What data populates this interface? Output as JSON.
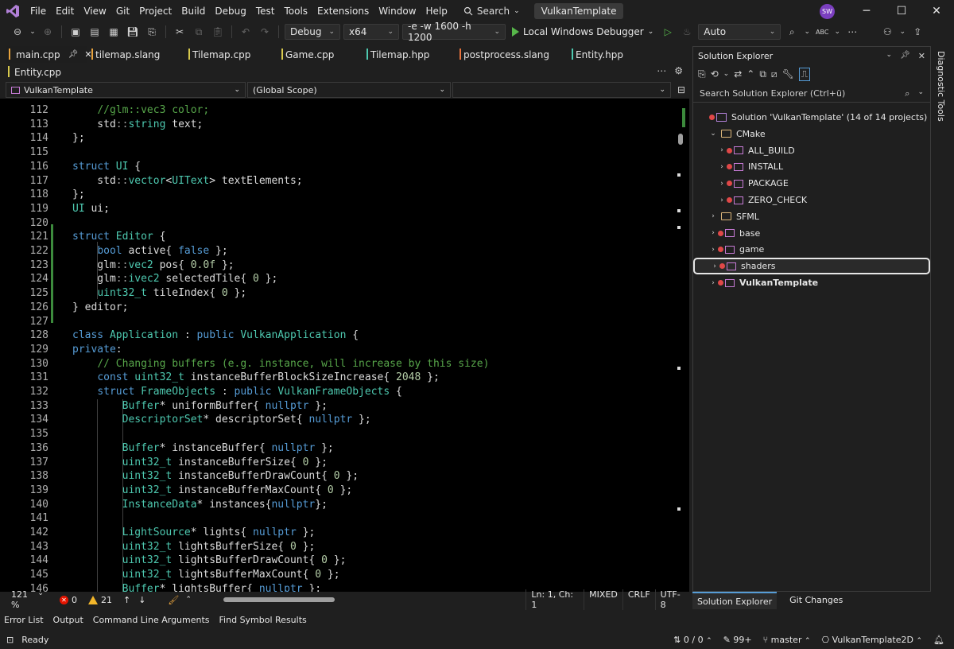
{
  "menu": {
    "items": [
      "File",
      "Edit",
      "View",
      "Git",
      "Project",
      "Build",
      "Debug",
      "Test",
      "Tools",
      "Extensions",
      "Window",
      "Help"
    ],
    "search_label": "Search",
    "solution_name": "VulkanTemplate",
    "user_initials": "SW"
  },
  "toolbar": {
    "config": "Debug",
    "platform": "x64",
    "args": "-e -w 1600 -h 1200",
    "run_label": "Local Windows Debugger",
    "auto": "Auto"
  },
  "doc_tabs": [
    {
      "label": "main.cpp",
      "color": "#e8a33d",
      "active": true
    },
    {
      "label": "tilemap.slang",
      "color": "#e8a33d"
    },
    {
      "label": "Tilemap.cpp",
      "color": "#d7c94d"
    },
    {
      "label": "Game.cpp",
      "color": "#d7c94d"
    },
    {
      "label": "Tilemap.hpp",
      "color": "#4ec9b0"
    },
    {
      "label": "postprocess.slang",
      "color": "#e8733d"
    },
    {
      "label": "Entity.hpp",
      "color": "#4ec9b0"
    },
    {
      "label": "Entity.cpp",
      "color": "#d7c94d"
    }
  ],
  "navbar": {
    "project": "VulkanTemplate",
    "scope": "(Global Scope)",
    "member": ""
  },
  "code_lines": [
    {
      "n": 112,
      "html": "    <span class=\"cm\">//glm::vec3 color;</span>"
    },
    {
      "n": 113,
      "html": "    std<span class=\"ns\">::</span><span class=\"ty\">string</span> text;"
    },
    {
      "n": 114,
      "html": "};"
    },
    {
      "n": 115,
      "html": ""
    },
    {
      "n": 116,
      "html": "<span class=\"kw\">struct</span> <span class=\"ty\">UI</span> {"
    },
    {
      "n": 117,
      "html": "    std<span class=\"ns\">::</span><span class=\"ty\">vector</span>&lt;<span class=\"ty\">UIText</span>&gt; textElements;"
    },
    {
      "n": 118,
      "html": "};"
    },
    {
      "n": 119,
      "html": "<span class=\"ty\">UI</span> ui;"
    },
    {
      "n": 120,
      "html": ""
    },
    {
      "n": 121,
      "html": "<span class=\"kw\">struct</span> <span class=\"ty\">Editor</span> {"
    },
    {
      "n": 122,
      "html": "    <span class=\"kw\">bool</span> active{ <span class=\"kw\">false</span> };"
    },
    {
      "n": 123,
      "html": "    glm<span class=\"ns\">::</span><span class=\"ty\">vec2</span> pos{ <span class=\"nu\">0.0f</span> };"
    },
    {
      "n": 124,
      "html": "    glm<span class=\"ns\">::</span><span class=\"ty\">ivec2</span> selectedTile{ <span class=\"nu\">0</span> };"
    },
    {
      "n": 125,
      "html": "    <span class=\"ty\">uint32_t</span> tileIndex{ <span class=\"nu\">0</span> };"
    },
    {
      "n": 126,
      "html": "} editor;"
    },
    {
      "n": 127,
      "html": ""
    },
    {
      "n": 128,
      "html": "<span class=\"kw\">class</span> <span class=\"ty\">Application</span> : <span class=\"kw\">public</span> <span class=\"ty\">VulkanApplication</span> {"
    },
    {
      "n": 129,
      "html": "<span class=\"kw\">private</span>:"
    },
    {
      "n": 130,
      "html": "    <span class=\"cm\">// Changing buffers (e.g. instance, will increase by this size)</span>"
    },
    {
      "n": 131,
      "html": "    <span class=\"kw\">const</span> <span class=\"ty\">uint32_t</span> instanceBufferBlockSizeIncrease{ <span class=\"nu\">2048</span> };"
    },
    {
      "n": 132,
      "html": "    <span class=\"kw\">struct</span> <span class=\"ty\">FrameObjects</span> : <span class=\"kw\">public</span> <span class=\"ty\">VulkanFrameObjects</span> {"
    },
    {
      "n": 133,
      "html": "        <span class=\"ty\">Buffer</span>* uniformBuffer{ <span class=\"kw\">nullptr</span> };"
    },
    {
      "n": 134,
      "html": "        <span class=\"ty\">DescriptorSet</span>* descriptorSet{ <span class=\"kw\">nullptr</span> };"
    },
    {
      "n": 135,
      "html": ""
    },
    {
      "n": 136,
      "html": "        <span class=\"ty\">Buffer</span>* instanceBuffer{ <span class=\"kw\">nullptr</span> };"
    },
    {
      "n": 137,
      "html": "        <span class=\"ty\">uint32_t</span> instanceBufferSize{ <span class=\"nu\">0</span> };"
    },
    {
      "n": 138,
      "html": "        <span class=\"ty\">uint32_t</span> instanceBufferDrawCount{ <span class=\"nu\">0</span> };"
    },
    {
      "n": 139,
      "html": "        <span class=\"ty\">uint32_t</span> instanceBufferMaxCount{ <span class=\"nu\">0</span> };"
    },
    {
      "n": 140,
      "html": "        <span class=\"ty\">InstanceData</span>* instances{<span class=\"kw\">nullptr</span>};"
    },
    {
      "n": 141,
      "html": ""
    },
    {
      "n": 142,
      "html": "        <span class=\"ty\">LightSource</span>* lights{ <span class=\"kw\">nullptr</span> };"
    },
    {
      "n": 143,
      "html": "        <span class=\"ty\">uint32_t</span> lightsBufferSize{ <span class=\"nu\">0</span> };"
    },
    {
      "n": 144,
      "html": "        <span class=\"ty\">uint32_t</span> lightsBufferDrawCount{ <span class=\"nu\">0</span> };"
    },
    {
      "n": 145,
      "html": "        <span class=\"ty\">uint32_t</span> lightsBufferMaxCount{ <span class=\"nu\">0</span> };"
    },
    {
      "n": 146,
      "html": "        <span class=\"ty\">Buffer</span>* lightsBuffer{ <span class=\"kw\">nullptr</span> };"
    }
  ],
  "editor_status": {
    "zoom": "121 %",
    "errors": "0",
    "warnings": "21",
    "position": "Ln: 1, Ch: 1",
    "indent": "MIXED",
    "eol": "CRLF",
    "encoding": "UTF-8"
  },
  "solution_explorer": {
    "title": "Solution Explorer",
    "search_placeholder": "Search Solution Explorer (Ctrl+ü)",
    "nodes": [
      {
        "label": "Solution 'VulkanTemplate' (14 of 14 projects)",
        "kind": "solution",
        "depth": 0,
        "twisty": ""
      },
      {
        "label": "CMake",
        "kind": "folder",
        "depth": 1,
        "twisty": "expanded"
      },
      {
        "label": "ALL_BUILD",
        "kind": "project",
        "depth": 2,
        "twisty": "collapsed"
      },
      {
        "label": "INSTALL",
        "kind": "project",
        "depth": 2,
        "twisty": "collapsed"
      },
      {
        "label": "PACKAGE",
        "kind": "project",
        "depth": 2,
        "twisty": "collapsed"
      },
      {
        "label": "ZERO_CHECK",
        "kind": "project",
        "depth": 2,
        "twisty": "collapsed"
      },
      {
        "label": "SFML",
        "kind": "folder",
        "depth": 1,
        "twisty": "collapsed"
      },
      {
        "label": "base",
        "kind": "project",
        "depth": 1,
        "twisty": "collapsed"
      },
      {
        "label": "game",
        "kind": "project",
        "depth": 1,
        "twisty": "collapsed"
      },
      {
        "label": "shaders",
        "kind": "project",
        "depth": 1,
        "twisty": "collapsed",
        "selected": true
      },
      {
        "label": "VulkanTemplate",
        "kind": "project",
        "depth": 1,
        "twisty": "collapsed",
        "bold": true
      }
    ],
    "tabs": [
      "Solution Explorer",
      "Git Changes"
    ]
  },
  "diagnostic_tools": "Diagnostic Tools",
  "bottom_tabs": [
    "Error List",
    "Output",
    "Command Line Arguments",
    "Find Symbol Results"
  ],
  "statusbar": {
    "ready": "Ready",
    "changes": "0 / 0",
    "edits": "99+",
    "branch": "master",
    "repo": "VulkanTemplate2D"
  },
  "colors": {
    "accent": "#569cd6",
    "keyword": "#569cd6",
    "type": "#4ec9b0",
    "comment": "#57a64a",
    "number": "#b5cea8",
    "change_bar": "#3c8a3c",
    "avatar": "#7b3fbf"
  }
}
